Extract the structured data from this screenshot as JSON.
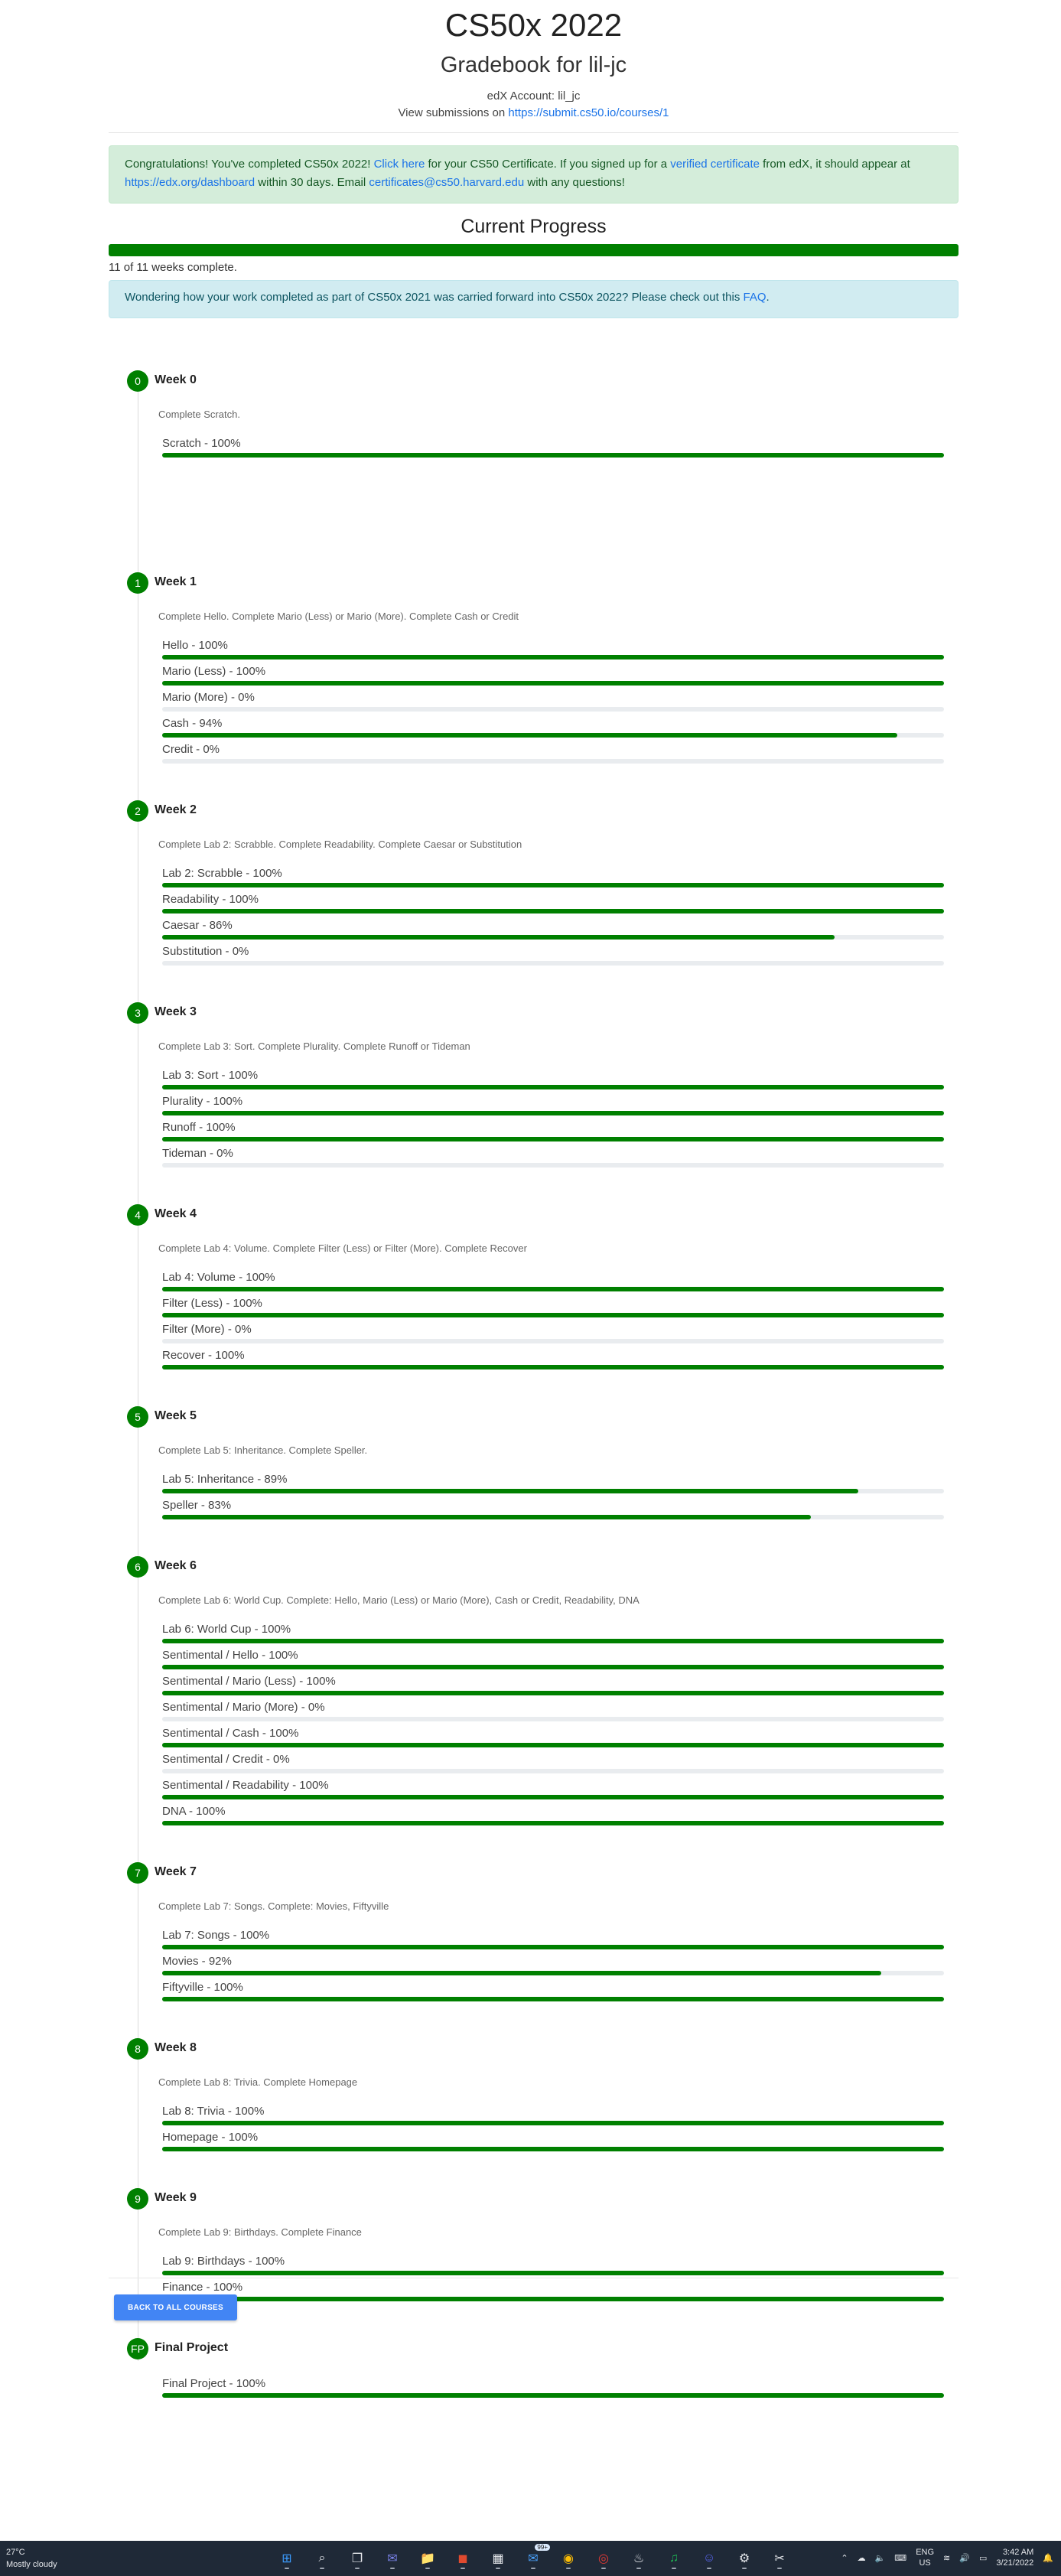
{
  "header": {
    "title": "CS50x 2022",
    "subtitle": "Gradebook for lil-jc",
    "account_prefix": "edX Account: ",
    "account": "lil_jc",
    "submissions_prefix": "View submissions on ",
    "submissions_link": "https://submit.cs50.io/courses/1"
  },
  "congrats": {
    "t1": "Congratulations! You've completed CS50x 2022! ",
    "link1": "Click here",
    "t2": " for your CS50 Certificate. If you signed up for a ",
    "link2": "verified certificate",
    "t3": " from edX, it should appear at ",
    "link3": "https://edx.org/dashboard",
    "t4": " within 30 days. Email ",
    "link4": "certificates@cs50.harvard.edu",
    "t5": " with any questions!"
  },
  "progress": {
    "heading": "Current Progress",
    "fraction": 1.0,
    "weeks_complete": "11 of 11 weeks complete."
  },
  "info": {
    "t1": "Wondering how your work completed as part of CS50x 2021 was carried forward into CS50x 2022? Please check out this ",
    "link": "FAQ",
    "t2": "."
  },
  "weeks": [
    {
      "badge": "0",
      "title": "Week 0",
      "desc": "Complete Scratch.",
      "items": [
        {
          "label": "Scratch - 100%",
          "pct": 100
        }
      ]
    },
    {
      "badge": "1",
      "title": "Week 1",
      "desc": "Complete Hello. Complete Mario (Less) or Mario (More). Complete Cash or Credit",
      "items": [
        {
          "label": "Hello - 100%",
          "pct": 100
        },
        {
          "label": "Mario (Less) - 100%",
          "pct": 100
        },
        {
          "label": "Mario (More) - 0%",
          "pct": 0
        },
        {
          "label": "Cash - 94%",
          "pct": 94
        },
        {
          "label": "Credit - 0%",
          "pct": 0
        }
      ]
    },
    {
      "badge": "2",
      "title": "Week 2",
      "desc": "Complete Lab 2: Scrabble. Complete Readability. Complete Caesar or Substitution",
      "items": [
        {
          "label": "Lab 2: Scrabble - 100%",
          "pct": 100
        },
        {
          "label": "Readability - 100%",
          "pct": 100
        },
        {
          "label": "Caesar - 86%",
          "pct": 86
        },
        {
          "label": "Substitution - 0%",
          "pct": 0
        }
      ]
    },
    {
      "badge": "3",
      "title": "Week 3",
      "desc": "Complete Lab 3: Sort. Complete Plurality. Complete Runoff or Tideman",
      "items": [
        {
          "label": "Lab 3: Sort - 100%",
          "pct": 100
        },
        {
          "label": "Plurality - 100%",
          "pct": 100
        },
        {
          "label": "Runoff - 100%",
          "pct": 100
        },
        {
          "label": "Tideman - 0%",
          "pct": 0
        }
      ]
    },
    {
      "badge": "4",
      "title": "Week 4",
      "desc": "Complete Lab 4: Volume. Complete Filter (Less) or Filter (More). Complete Recover",
      "items": [
        {
          "label": "Lab 4: Volume - 100%",
          "pct": 100
        },
        {
          "label": "Filter (Less) - 100%",
          "pct": 100
        },
        {
          "label": "Filter (More) - 0%",
          "pct": 0
        },
        {
          "label": "Recover - 100%",
          "pct": 100
        }
      ]
    },
    {
      "badge": "5",
      "title": "Week 5",
      "desc": "Complete Lab 5: Inheritance. Complete Speller.",
      "items": [
        {
          "label": "Lab 5: Inheritance - 89%",
          "pct": 89
        },
        {
          "label": "Speller - 83%",
          "pct": 83
        }
      ]
    },
    {
      "badge": "6",
      "title": "Week 6",
      "desc": "Complete Lab 6: World Cup. Complete: Hello, Mario (Less) or Mario (More), Cash or Credit, Readability, DNA",
      "items": [
        {
          "label": "Lab 6: World Cup - 100%",
          "pct": 100
        },
        {
          "label": "Sentimental / Hello - 100%",
          "pct": 100
        },
        {
          "label": "Sentimental / Mario (Less) - 100%",
          "pct": 100
        },
        {
          "label": "Sentimental / Mario (More) - 0%",
          "pct": 0
        },
        {
          "label": "Sentimental / Cash - 100%",
          "pct": 100
        },
        {
          "label": "Sentimental / Credit - 0%",
          "pct": 0
        },
        {
          "label": "Sentimental / Readability - 100%",
          "pct": 100
        },
        {
          "label": "DNA - 100%",
          "pct": 100
        }
      ]
    },
    {
      "badge": "7",
      "title": "Week 7",
      "desc": "Complete Lab 7: Songs. Complete: Movies, Fiftyville",
      "items": [
        {
          "label": "Lab 7: Songs - 100%",
          "pct": 100
        },
        {
          "label": "Movies - 92%",
          "pct": 92
        },
        {
          "label": "Fiftyville - 100%",
          "pct": 100
        }
      ]
    },
    {
      "badge": "8",
      "title": "Week 8",
      "desc": "Complete Lab 8: Trivia. Complete Homepage",
      "items": [
        {
          "label": "Lab 8: Trivia - 100%",
          "pct": 100
        },
        {
          "label": "Homepage - 100%",
          "pct": 100
        }
      ]
    },
    {
      "badge": "9",
      "title": "Week 9",
      "desc": "Complete Lab 9: Birthdays. Complete Finance",
      "items": [
        {
          "label": "Lab 9: Birthdays - 100%",
          "pct": 100
        },
        {
          "label": "Finance - 100%",
          "pct": 100
        }
      ]
    },
    {
      "badge": "FP",
      "title": "Final Project",
      "desc": "",
      "items": [
        {
          "label": "Final Project - 100%",
          "pct": 100
        }
      ]
    }
  ],
  "back_button": "BACK TO ALL COURSES",
  "taskbar": {
    "temp": "27°C",
    "weather": "Mostly cloudy",
    "lang": "ENG",
    "region": "US",
    "time": "3:42 AM",
    "date": "3/21/2022",
    "mail_badge": "99+",
    "apps": [
      "windows-start-icon",
      "search-icon",
      "task-view-icon",
      "chat-icon",
      "file-explorer-icon",
      "office-icon",
      "calendar-icon",
      "mail-icon",
      "chrome-icon",
      "app-red-icon",
      "steam-icon",
      "spotify-icon",
      "discord-icon",
      "settings-icon",
      "snipping-tool-icon"
    ]
  },
  "colors": {
    "bar": "#008000",
    "link": "#1a73e8",
    "button": "#4285f4"
  }
}
